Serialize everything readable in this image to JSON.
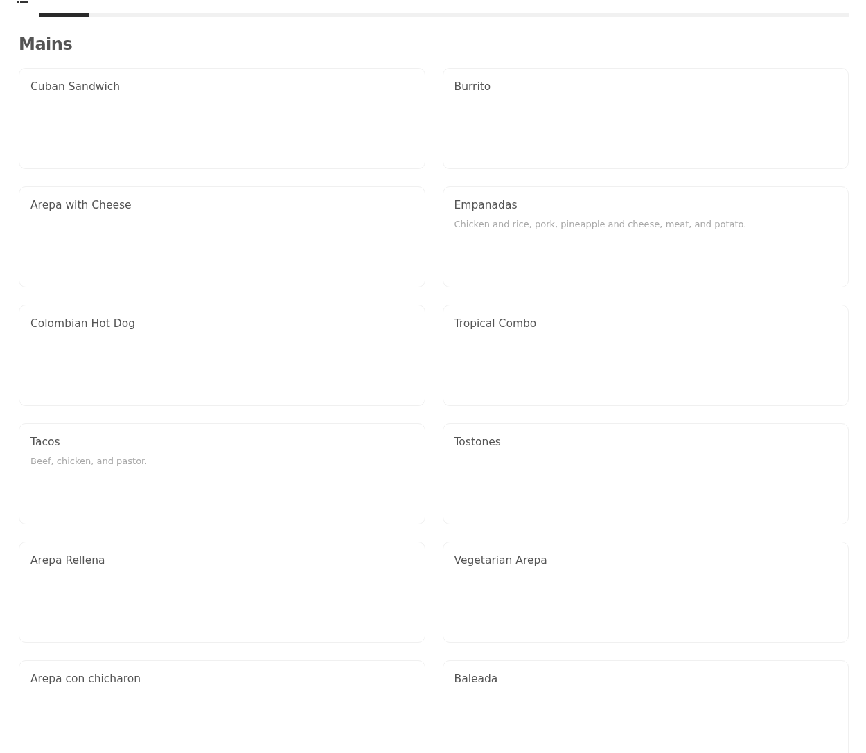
{
  "tabs": [
    {
      "selected": true
    }
  ],
  "section": {
    "title": "Mains"
  },
  "items": [
    {
      "name": "Cuban Sandwich"
    },
    {
      "name": "Burrito"
    },
    {
      "name": "Arepa with Cheese"
    },
    {
      "name": "Empanadas",
      "description": "Chicken and rice, pork, pineapple and cheese, meat, and potato."
    },
    {
      "name": "Colombian Hot Dog"
    },
    {
      "name": "Tropical Combo"
    },
    {
      "name": "Tacos",
      "description": "Beef, chicken, and pastor."
    },
    {
      "name": "Tostones"
    },
    {
      "name": "Arepa Rellena"
    },
    {
      "name": "Vegetarian Arepa"
    },
    {
      "name": "Arepa con chicharon"
    },
    {
      "name": "Baleada"
    }
  ]
}
